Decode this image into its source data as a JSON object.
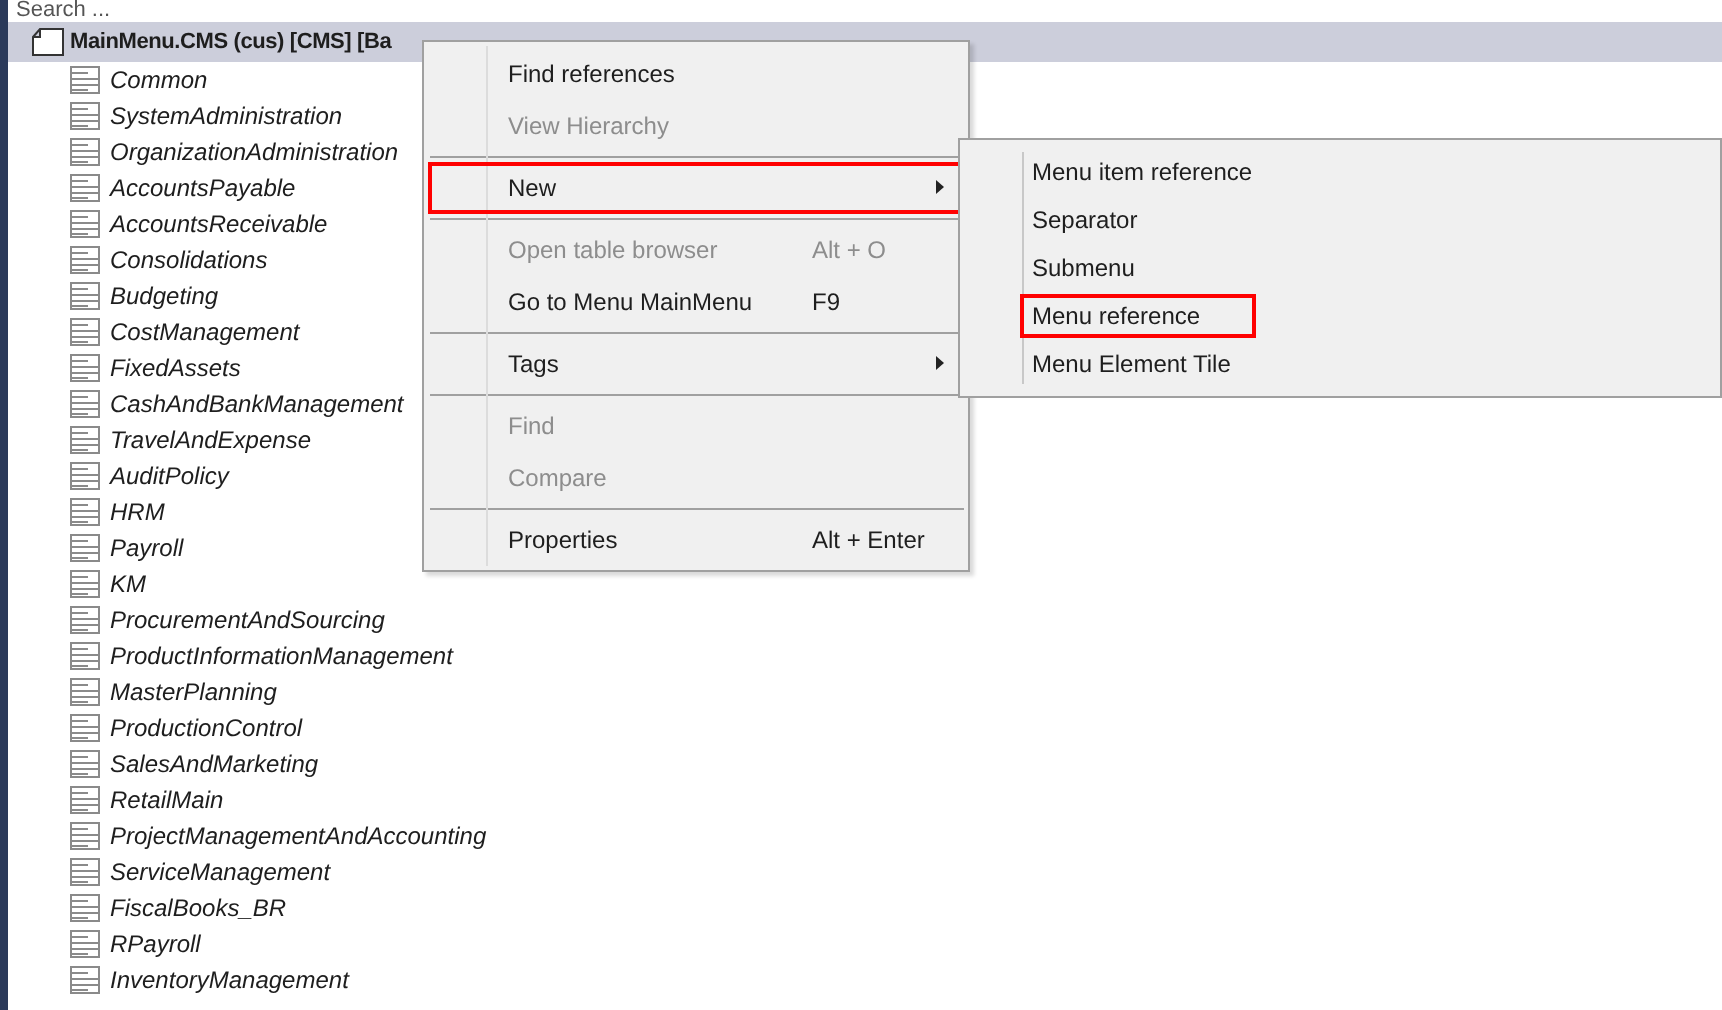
{
  "search": {
    "placeholder": "Search ..."
  },
  "tree": {
    "root": {
      "label": "MainMenu.CMS (cus) [CMS] [Ba",
      "selected": true
    },
    "children": [
      {
        "label": "Common"
      },
      {
        "label": "SystemAdministration"
      },
      {
        "label": "OrganizationAdministration"
      },
      {
        "label": "AccountsPayable"
      },
      {
        "label": "AccountsReceivable"
      },
      {
        "label": "Consolidations"
      },
      {
        "label": "Budgeting"
      },
      {
        "label": "CostManagement"
      },
      {
        "label": "FixedAssets"
      },
      {
        "label": "CashAndBankManagement"
      },
      {
        "label": "TravelAndExpense"
      },
      {
        "label": "AuditPolicy"
      },
      {
        "label": "HRM"
      },
      {
        "label": "Payroll"
      },
      {
        "label": "KM"
      },
      {
        "label": "ProcurementAndSourcing"
      },
      {
        "label": "ProductInformationManagement"
      },
      {
        "label": "MasterPlanning"
      },
      {
        "label": "ProductionControl"
      },
      {
        "label": "SalesAndMarketing"
      },
      {
        "label": "RetailMain"
      },
      {
        "label": "ProjectManagementAndAccounting"
      },
      {
        "label": "ServiceManagement"
      },
      {
        "label": "FiscalBooks_BR"
      },
      {
        "label": "RPayroll"
      },
      {
        "label": "InventoryManagement"
      }
    ]
  },
  "context_menu": {
    "groups": [
      [
        {
          "label": "Find references",
          "disabled": false,
          "submenu": false,
          "highlighted": false
        },
        {
          "label": "View Hierarchy",
          "disabled": true,
          "submenu": false,
          "highlighted": false
        }
      ],
      [
        {
          "label": "New",
          "disabled": false,
          "submenu": true,
          "highlighted": true
        }
      ],
      [
        {
          "label": "Open table browser",
          "shortcut": "Alt + O",
          "disabled": true,
          "submenu": false,
          "highlighted": false
        },
        {
          "label": "Go to Menu MainMenu",
          "shortcut": "F9",
          "disabled": false,
          "submenu": false,
          "highlighted": false
        }
      ],
      [
        {
          "label": "Tags",
          "disabled": false,
          "submenu": true,
          "highlighted": false
        }
      ],
      [
        {
          "label": "Find",
          "disabled": true,
          "submenu": false,
          "highlighted": false
        },
        {
          "label": "Compare",
          "disabled": true,
          "submenu": false,
          "highlighted": false
        }
      ],
      [
        {
          "label": "Properties",
          "shortcut": "Alt + Enter",
          "disabled": false,
          "submenu": false,
          "highlighted": false
        }
      ]
    ]
  },
  "submenu": {
    "items": [
      {
        "label": "Menu item reference",
        "highlighted": false
      },
      {
        "label": "Separator",
        "highlighted": false
      },
      {
        "label": "Submenu",
        "highlighted": false
      },
      {
        "label": "Menu reference",
        "highlighted": true
      },
      {
        "label": "Menu Element Tile",
        "highlighted": false
      }
    ]
  }
}
